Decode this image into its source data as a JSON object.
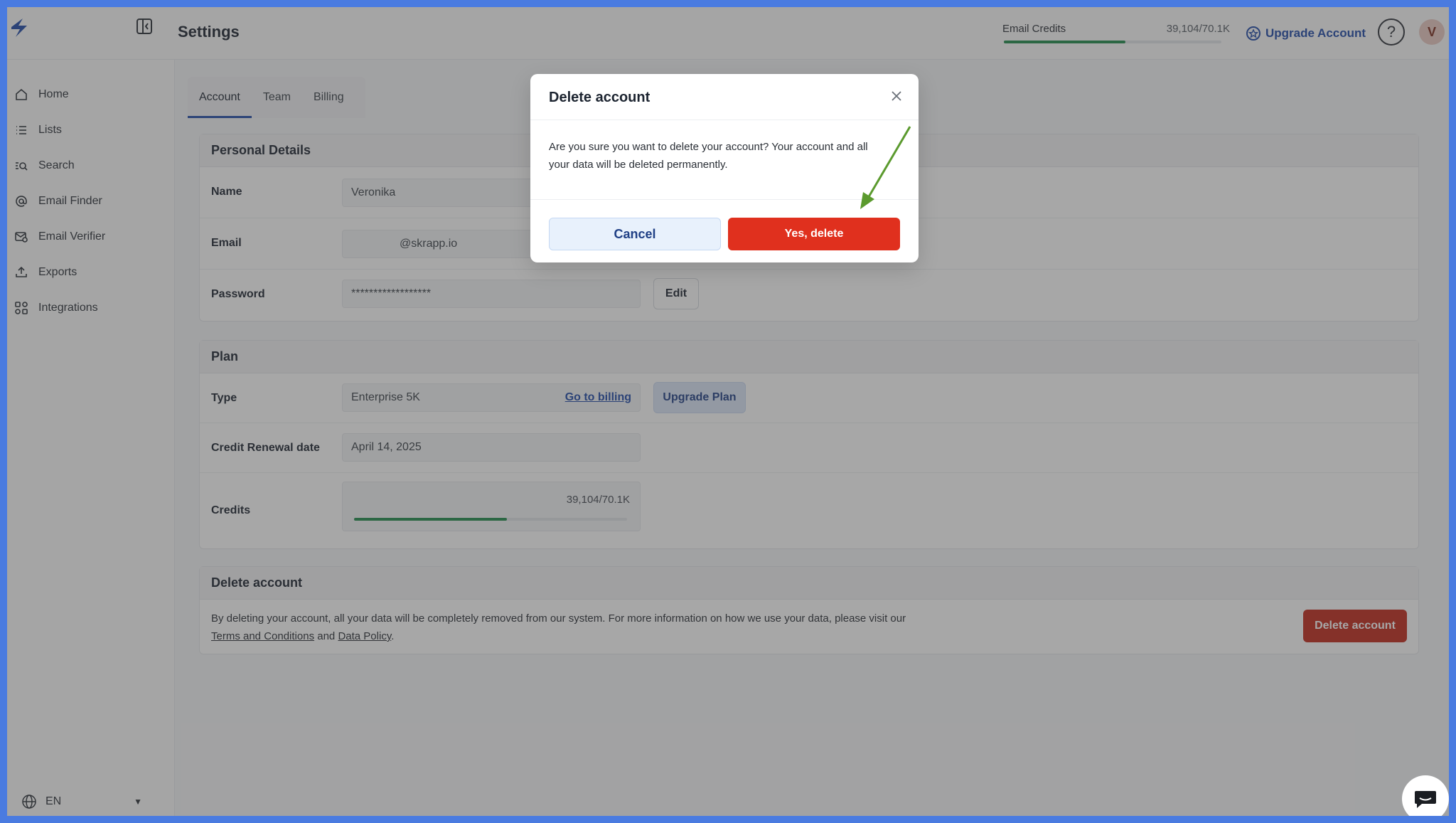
{
  "app": {
    "page_title": "Settings",
    "logo_icon": "skrapp-logo-icon"
  },
  "topbar": {
    "credits_label": "Email Credits",
    "credits_value": "39,104/70.1K",
    "credits_fraction": 0.56,
    "upgrade_label": "Upgrade Account",
    "help_glyph": "?",
    "avatar_initial": "V"
  },
  "sidebar": {
    "items": [
      {
        "label": "Home",
        "icon": "home-icon"
      },
      {
        "label": "Lists",
        "icon": "list-icon"
      },
      {
        "label": "Search",
        "icon": "search-icon"
      },
      {
        "label": "Email Finder",
        "icon": "at-icon"
      },
      {
        "label": "Email Verifier",
        "icon": "mail-check-icon"
      },
      {
        "label": "Exports",
        "icon": "export-icon"
      },
      {
        "label": "Integrations",
        "icon": "integrations-icon"
      }
    ],
    "language": "EN"
  },
  "tabs": [
    "Account",
    "Team",
    "Billing"
  ],
  "personal": {
    "title": "Personal Details",
    "name_label": "Name",
    "name_value": "Veronika",
    "email_label": "Email",
    "email_value": "@skrapp.io",
    "password_label": "Password",
    "password_value": "******************",
    "edit_label": "Edit"
  },
  "plan": {
    "title": "Plan",
    "type_label": "Type",
    "type_value": "Enterprise 5K",
    "billing_link": "Go to billing",
    "upgrade_label": "Upgrade Plan",
    "renewal_label": "Credit Renewal date",
    "renewal_value": "April 14, 2025",
    "credits_label": "Credits",
    "credits_value": "39,104/70.1K",
    "credits_fraction": 0.56
  },
  "delete": {
    "title": "Delete account",
    "text_before": "By deleting your account, all your data will be completely removed from our system. For more information on how we use your data, please visit our ",
    "terms_link": "Terms and Conditions",
    "and_text": " and ",
    "policy_link": "Data Policy",
    "period": ".",
    "button_label": "Delete account"
  },
  "modal": {
    "title": "Delete account",
    "body": "Are you sure you want to delete your account? Your account and all your data will be deleted permanently.",
    "cancel_label": "Cancel",
    "confirm_label": "Yes, delete"
  },
  "colors": {
    "accent": "#1f4aa8",
    "danger": "#e0301e",
    "progress": "#1f8a4c",
    "annotation_arrow": "#5b9a2e"
  }
}
